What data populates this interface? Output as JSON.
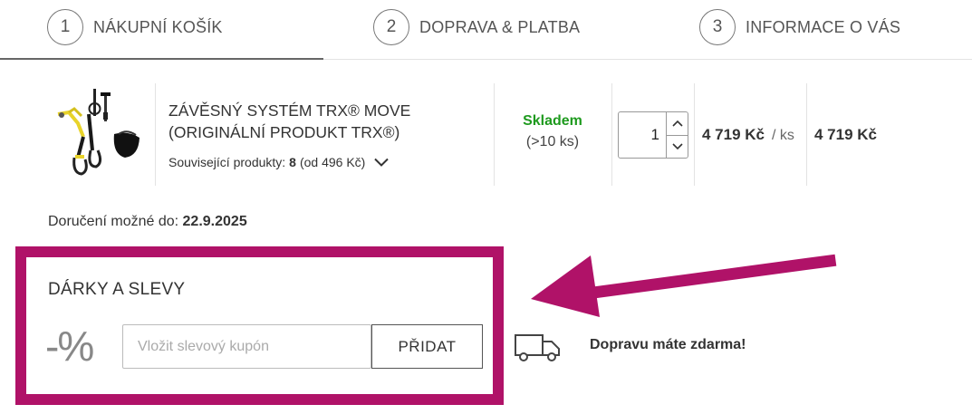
{
  "steps": [
    {
      "number": "1",
      "label": "NÁKUPNÍ KOŠÍK",
      "active": true
    },
    {
      "number": "2",
      "label": "DOPRAVA & PLATBA",
      "active": false
    },
    {
      "number": "3",
      "label": "INFORMACE O VÁS",
      "active": false
    }
  ],
  "item": {
    "name_line1": "ZÁVĚSNÝ SYSTÉM TRX® MOVE",
    "name_line2": "(ORIGINÁLNÍ PRODUKT TRX®)",
    "related_label": "Související produkty:",
    "related_count": "8",
    "related_from": "(od 496 Kč)",
    "availability": "Skladem",
    "stock_count": "(>10 ks)",
    "quantity": "1",
    "unit_price": "4 719 Kč",
    "unit_suffix": "/ ks",
    "total_price": "4 719 Kč"
  },
  "delivery": {
    "label": "Doručení možné do:",
    "date": "22.9.2025"
  },
  "discount": {
    "title": "DÁRKY A SLEVY",
    "percent_symbol": "-%",
    "coupon_placeholder": "Vložit slevový kupón",
    "coupon_value": "",
    "add_button": "PŘIDAT"
  },
  "shipping": {
    "message": "Dopravu máte zdarma!",
    "icon": "truck-icon"
  },
  "colors": {
    "highlight": "#b01268",
    "in_stock": "#1e9a1e"
  }
}
